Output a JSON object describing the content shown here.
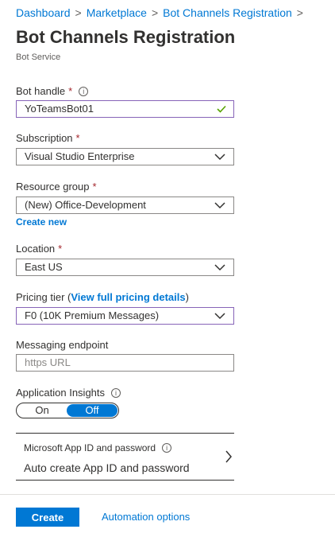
{
  "breadcrumb": {
    "items": [
      "Dashboard",
      "Marketplace",
      "Bot Channels Registration"
    ],
    "separator": ">"
  },
  "page": {
    "title": "Bot Channels Registration",
    "subtitle": "Bot Service"
  },
  "form": {
    "bot_handle": {
      "label": "Bot handle",
      "required": "*",
      "value": "YoTeamsBot01"
    },
    "subscription": {
      "label": "Subscription",
      "required": "*",
      "value": "Visual Studio Enterprise"
    },
    "resource_group": {
      "label": "Resource group",
      "required": "*",
      "value": "(New) Office-Development",
      "create_new": "Create new"
    },
    "location": {
      "label": "Location",
      "required": "*",
      "value": "East US"
    },
    "pricing_tier": {
      "label_prefix": "Pricing tier (",
      "link": "View full pricing details",
      "label_suffix": ")",
      "value": "F0 (10K Premium Messages)"
    },
    "messaging_endpoint": {
      "label": "Messaging endpoint",
      "placeholder": "https URL"
    },
    "app_insights": {
      "label": "Application Insights",
      "on": "On",
      "off": "Off",
      "selected": "Off"
    },
    "app_id": {
      "title": "Microsoft App ID and password",
      "value": "Auto create App ID and password"
    }
  },
  "footer": {
    "create": "Create",
    "automation": "Automation options"
  },
  "colors": {
    "accent": "#0078d4",
    "required": "#a4262c",
    "focus_border": "#8764b8",
    "valid_check": "#57a300"
  }
}
